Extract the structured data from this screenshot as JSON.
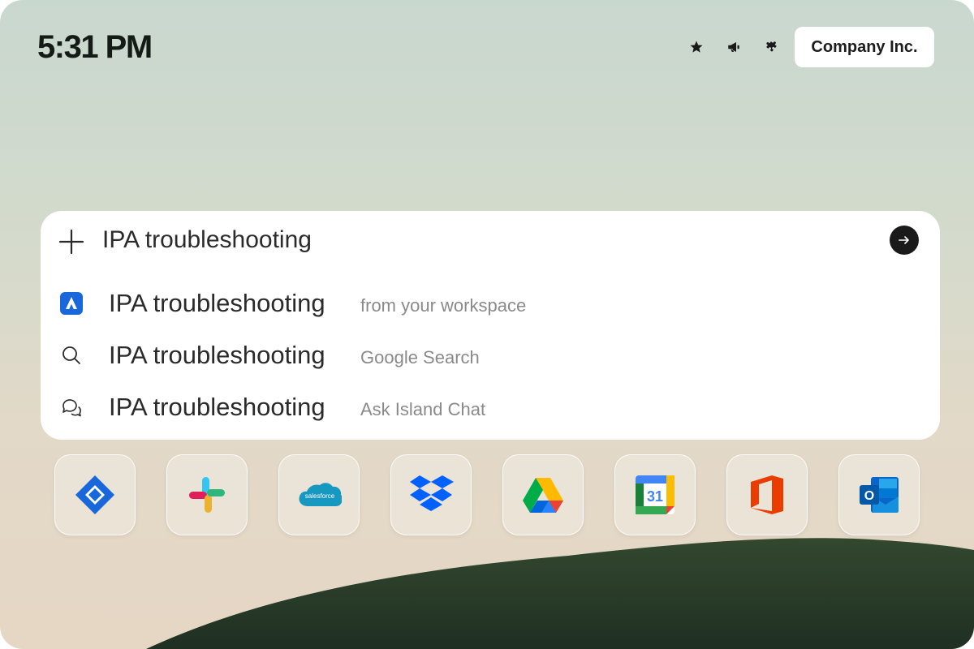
{
  "status_bar": {
    "time": "5:31 PM"
  },
  "top_actions": {
    "icons": [
      "star-icon",
      "megaphone-icon",
      "puzzle-icon"
    ],
    "company_label": "Company Inc."
  },
  "search": {
    "query": "IPA troubleshooting"
  },
  "suggestions": [
    {
      "icon": "atlassian-icon",
      "text": "IPA troubleshooting",
      "source": "from your workspace"
    },
    {
      "icon": "search-icon",
      "text": "IPA troubleshooting",
      "source": "Google Search"
    },
    {
      "icon": "chat-bubbles-icon",
      "text": "IPA troubleshooting",
      "source": "Ask Island Chat"
    }
  ],
  "apps": [
    {
      "name": "Jira",
      "icon": "jira-icon"
    },
    {
      "name": "Slack",
      "icon": "slack-icon"
    },
    {
      "name": "Salesforce",
      "icon": "salesforce-icon",
      "logo_text": "salesforce"
    },
    {
      "name": "Dropbox",
      "icon": "dropbox-icon"
    },
    {
      "name": "Google Drive",
      "icon": "google-drive-icon"
    },
    {
      "name": "Google Calendar",
      "icon": "google-calendar-icon",
      "logo_text": "31"
    },
    {
      "name": "Microsoft Office",
      "icon": "office-icon"
    },
    {
      "name": "Outlook",
      "icon": "outlook-icon",
      "logo_text": "O"
    }
  ],
  "colors": {
    "background_top": "#c9d8cf",
    "background_bottom": "#e6d6c4",
    "hill": "#2b3d2c",
    "panel": "#ffffff",
    "accent_dark": "#1a1a1a",
    "atlassian_blue": "#1868db"
  }
}
